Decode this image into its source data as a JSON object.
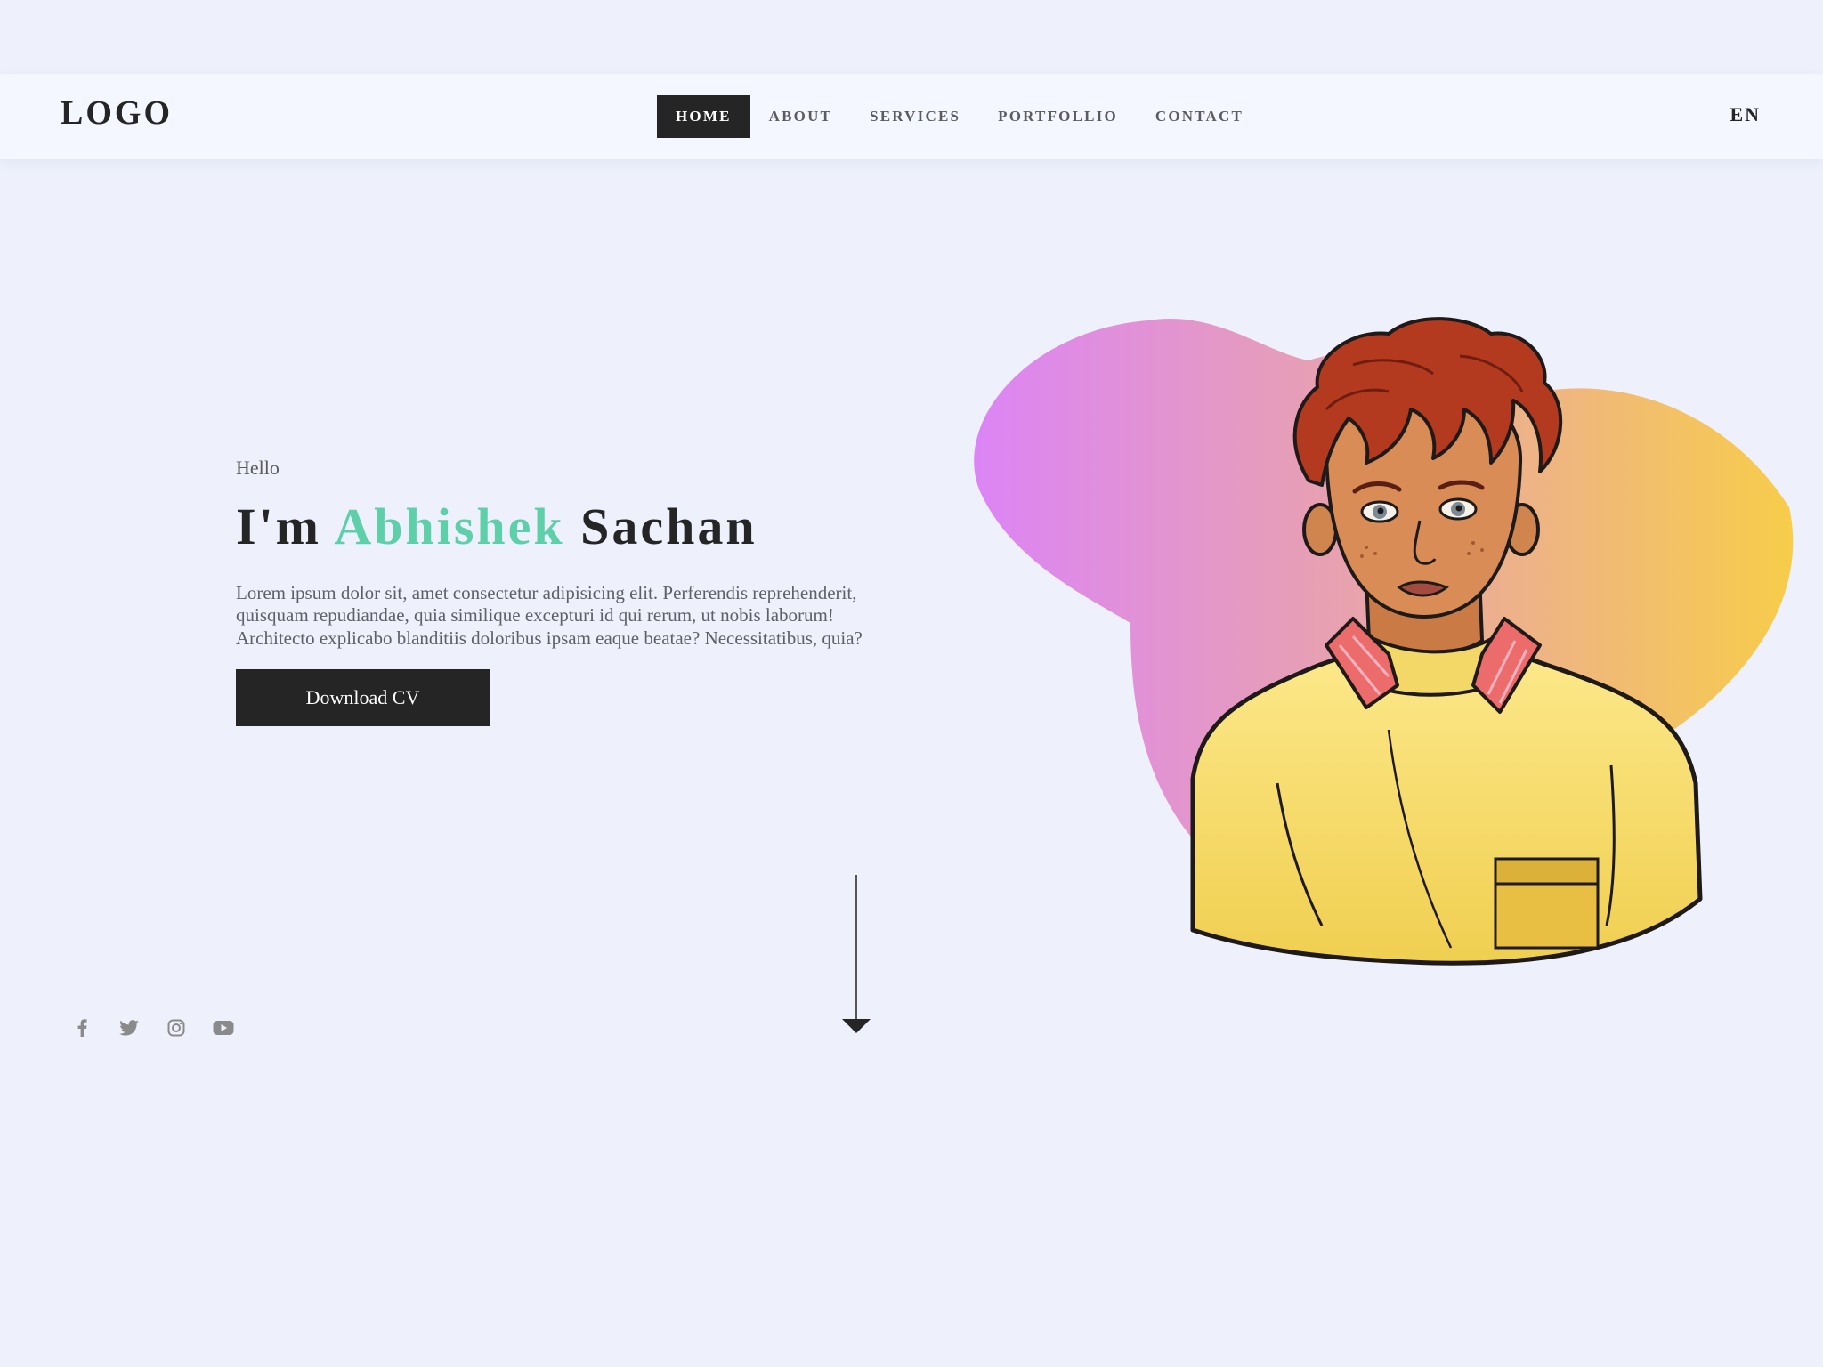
{
  "header": {
    "logo": "LOGO",
    "nav": [
      {
        "label": "HOME",
        "active": true
      },
      {
        "label": "ABOUT",
        "active": false
      },
      {
        "label": "SERVICES",
        "active": false
      },
      {
        "label": "PORTFOLLIO",
        "active": false
      },
      {
        "label": "CONTACT",
        "active": false
      }
    ],
    "language": "EN"
  },
  "hero": {
    "greeting": "Hello",
    "heading_prefix": "I'm",
    "first_name": "Abhishek",
    "last_name": "Sachan",
    "description": "Lorem ipsum dolor sit, amet consectetur adipisicing elit. Perferendis reprehenderit, quisquam repudiandae, quia similique excepturi id qui rerum, ut nobis laborum! Architecto explicabo blanditiis doloribus ipsam eaque beatae? Necessitatibus, quia?",
    "cta_label": "Download CV"
  },
  "socials": [
    {
      "icon": "facebook-icon"
    },
    {
      "icon": "twitter-icon"
    },
    {
      "icon": "instagram-icon"
    },
    {
      "icon": "youtube-icon"
    }
  ],
  "illustration": {
    "subject": "avatar-illustration",
    "blob_colors": [
      "#dc84f6",
      "#e9a5a7",
      "#f7cd4a"
    ]
  },
  "colors": {
    "accent": "#5dcfa9",
    "dark": "#252525",
    "background": "#eef1fc",
    "navbar": "#f4f7ff",
    "muted_text": "#5f6067",
    "icon_gray": "#8a8a8a"
  }
}
